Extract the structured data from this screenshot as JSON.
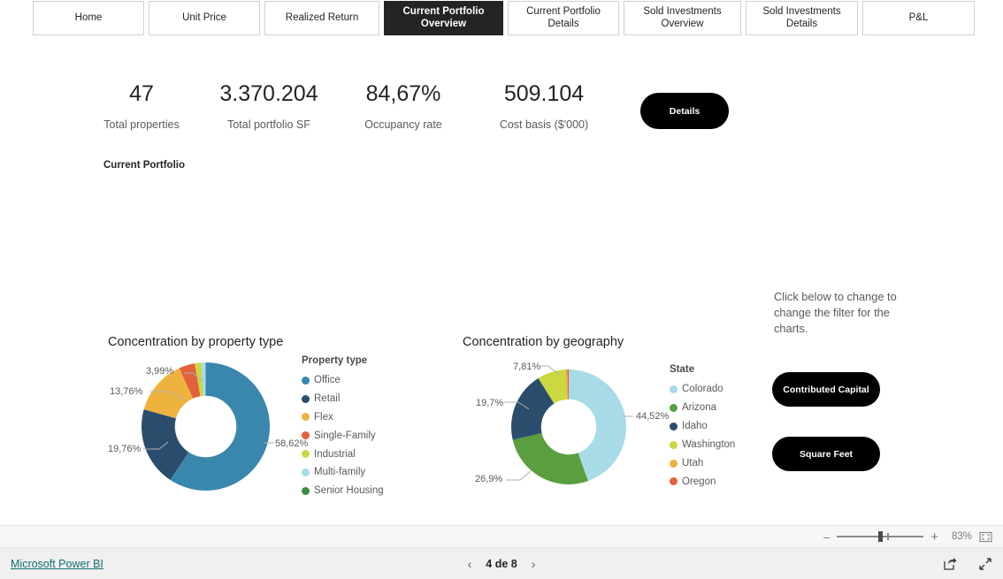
{
  "tabs": [
    {
      "label": "Home",
      "active": false
    },
    {
      "label": "Unit Price",
      "active": false
    },
    {
      "label": "Realized Return",
      "active": false
    },
    {
      "label": "Current Portfolio Overview",
      "active": true
    },
    {
      "label": "Current Portfolio Details",
      "active": false
    },
    {
      "label": "Sold Investments Overview",
      "active": false
    },
    {
      "label": "Sold Investments Details",
      "active": false
    },
    {
      "label": "P&L",
      "active": false
    }
  ],
  "kpis": [
    {
      "value": "47",
      "label": "Total properties"
    },
    {
      "value": "3.370.204",
      "label": "Total portfolio SF"
    },
    {
      "value": "84,67%",
      "label": "Occupancy rate"
    },
    {
      "value": "509.104",
      "label": "Cost basis ($'000)"
    }
  ],
  "details_button": "Details",
  "section_title": "Current Portfolio",
  "hint": "Click below to change to change the filter for the charts.",
  "filter_buttons": {
    "contributed_capital": "Contributed Capital",
    "square_feet": "Square Feet"
  },
  "status_bar": {
    "zoom_percent": "83%",
    "minus": "–",
    "plus": "+",
    "fit_icon": "fit-to-page-icon"
  },
  "footer": {
    "brand_link": "Microsoft Power BI",
    "prev_arrow": "‹",
    "next_arrow": "›",
    "page_label": "4 de 8",
    "share_icon": "share-icon",
    "fullscreen_icon": "fullscreen-icon"
  },
  "chart_data": [
    {
      "type": "pie",
      "title": "Concentration by property type",
      "legend_title": "Property type",
      "legend_position": "right",
      "hole": 0.48,
      "categories": [
        "Office",
        "Retail",
        "Flex",
        "Single-Family",
        "Industrial",
        "Multi-family",
        "Senior Housing"
      ],
      "values": [
        58.62,
        19.76,
        13.76,
        3.99,
        1.6,
        1.1,
        0.0
      ],
      "colors": [
        "#3a87ad",
        "#2a4d6e",
        "#eeb33f",
        "#e2603b",
        "#c9d93f",
        "#a8dbe8",
        "#3d8b43"
      ],
      "labels_shown": [
        "58,62%",
        "19,76%",
        "13,76%",
        "3,99%"
      ],
      "value_suffix": "%"
    },
    {
      "type": "pie",
      "title": "Concentration by geography",
      "legend_title": "State",
      "legend_position": "right",
      "hole": 0.48,
      "categories": [
        "Colorado",
        "Arizona",
        "Idaho",
        "Washington",
        "Utah",
        "Oregon"
      ],
      "values": [
        44.52,
        26.9,
        19.7,
        7.81,
        0.7,
        0.37
      ],
      "colors": [
        "#a8dbe8",
        "#5a9e3f",
        "#2a4d6e",
        "#c9d93f",
        "#eeb33f",
        "#e2603b"
      ],
      "labels_shown": [
        "44,52%",
        "26,9%",
        "19,7%",
        "7,81%"
      ],
      "value_suffix": "%"
    }
  ]
}
